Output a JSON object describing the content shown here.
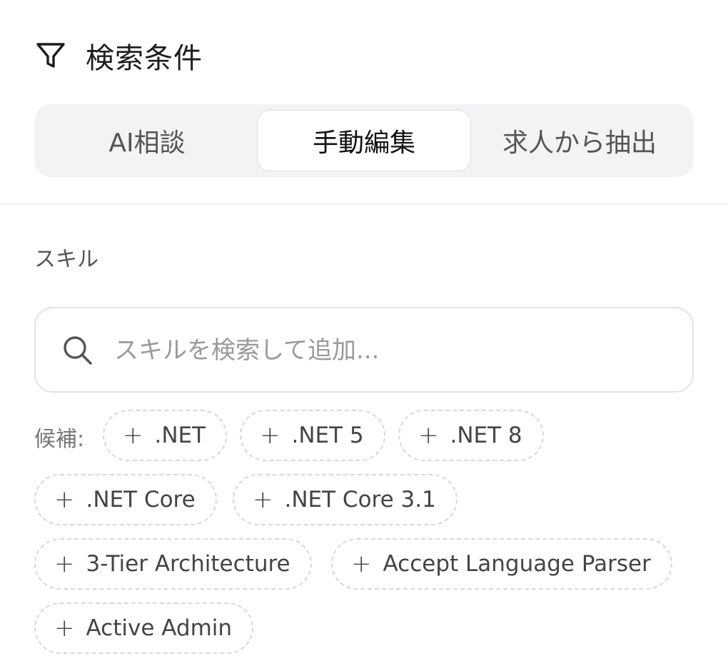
{
  "header": {
    "icon": "filter-icon",
    "title": "検索条件"
  },
  "tabs": [
    {
      "label": "AI相談",
      "selected": false
    },
    {
      "label": "手動編集",
      "selected": true
    },
    {
      "label": "求人から抽出",
      "selected": false
    }
  ],
  "skills": {
    "label": "スキル",
    "search": {
      "icon": "search-icon",
      "placeholder": "スキルを検索して追加...",
      "value": ""
    },
    "suggestions_label": "候補:",
    "suggestions": [
      {
        "plus": "+",
        "label": ".NET"
      },
      {
        "plus": "+",
        "label": ".NET 5"
      },
      {
        "plus": "+",
        "label": ".NET 8"
      },
      {
        "plus": "+",
        "label": ".NET Core"
      },
      {
        "plus": "+",
        "label": ".NET Core 3.1"
      },
      {
        "plus": "+",
        "label": "3-Tier Architecture"
      },
      {
        "plus": "+",
        "label": "Accept Language Parser"
      },
      {
        "plus": "+",
        "label": "Active Admin"
      }
    ]
  },
  "colors": {
    "tab_bg": "#f3f3f5",
    "selected_tab_bg": "#ffffff",
    "chip_border": "#d8d8d8",
    "muted_text": "#777777"
  }
}
